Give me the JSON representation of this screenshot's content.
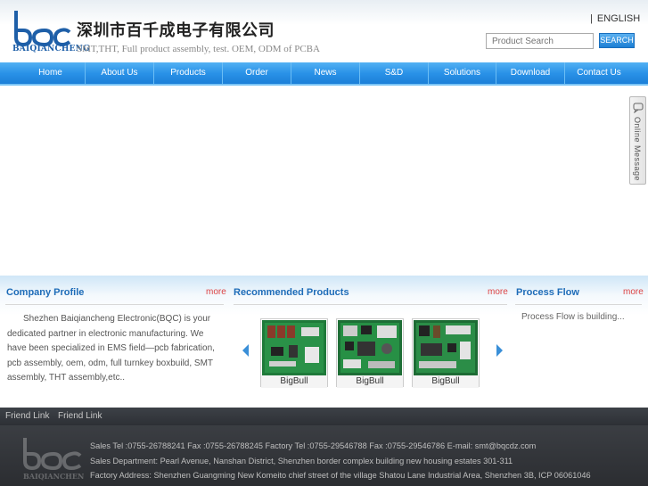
{
  "header": {
    "logo_text": "BAIQIANCHENG",
    "company_cn": "深圳市百千成电子有限公司",
    "company_en": "SMT,THT, Full product assembly, test. OEM, ODM of PCBA",
    "lang_sep": "|",
    "lang_label": "ENGLISH",
    "search_placeholder": "Product Search",
    "search_button": "SEARCH"
  },
  "nav": {
    "items": [
      "Home",
      "About Us",
      "Products",
      "Order",
      "News",
      "S&D",
      "Solutions",
      "Download",
      "Contact Us"
    ]
  },
  "online": {
    "label": "Online Message"
  },
  "company_profile": {
    "title": "Company Profile",
    "more": "more",
    "text": "Shezhen Baiqiancheng Electronic(BQC) is your dedicated partner in electronic manufacturing. We have been specialized in EMS field—pcb fabrication, pcb assembly, oem, odm, full turnkey boxbuild, SMT assembly, THT assembly,etc.."
  },
  "recommended": {
    "title": "Recommended Products",
    "more": "more",
    "products": [
      {
        "label": "BigBull"
      },
      {
        "label": "BigBull"
      },
      {
        "label": "BigBull"
      }
    ]
  },
  "process_flow": {
    "title": "Process Flow",
    "more": "more",
    "text": "Process Flow is building..."
  },
  "friend_links": [
    "Friend Link",
    "Friend Link"
  ],
  "footer": {
    "logo_text": "BAIQIANCHENG",
    "line1": "Sales Tel :0755-26788241 Fax :0755-26788245 Factory Tel :0755-29546788 Fax :0755-29546786 E-mail: smt@bqcdz.com",
    "line2": "Sales Department: Pearl Avenue, Nanshan District, Shenzhen border complex building new housing estates 301-311",
    "line3": "Factory Address: Shenzhen Guangming New Komeito chief street of the village Shatou Lane Industrial Area, Shenzhen 3B,   ICP   06061046"
  },
  "colors": {
    "nav_blue": "#2a92e8",
    "title_blue": "#1e6cb8",
    "more_red": "#dd4444",
    "footer_dark": "#2d3035"
  }
}
